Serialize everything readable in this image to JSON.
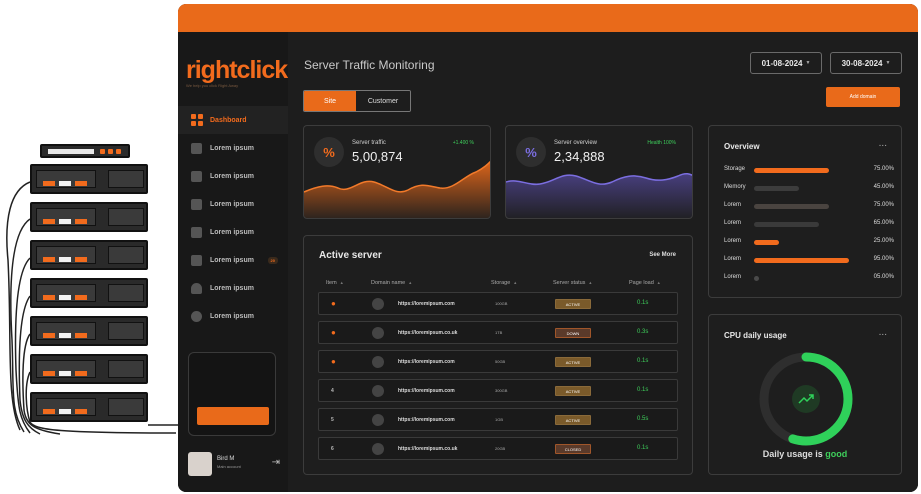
{
  "brand": {
    "logo_text": "rightclick",
    "tagline": "We help you click Right Away"
  },
  "sidebar": {
    "items": [
      {
        "label": "Dashboard",
        "icon": "dashboard-icon",
        "active": true
      },
      {
        "label": "Lorem ipsum",
        "icon": "chart-icon"
      },
      {
        "label": "Lorem ipsum",
        "icon": "grid-icon"
      },
      {
        "label": "Lorem ipsum",
        "icon": "document-icon"
      },
      {
        "label": "Lorem ipsum",
        "icon": "calendar-icon"
      },
      {
        "label": "Lorem ipsum",
        "icon": "message-icon",
        "badge": "20"
      },
      {
        "label": "Lorem ipsum",
        "icon": "bell-icon"
      },
      {
        "label": "Lorem ipsum",
        "icon": "gear-icon"
      }
    ],
    "account": {
      "name": "Bird M",
      "role": "Main account"
    }
  },
  "header": {
    "title": "Server Traffic Monitoring",
    "date_from": "01-08-2024",
    "date_to": "30-08-2024",
    "add_domain_label": "Add domain",
    "tabs": [
      {
        "label": "Site",
        "active": true
      },
      {
        "label": "Customer"
      }
    ]
  },
  "stats": {
    "traffic": {
      "icon": "%",
      "label": "Server traffic",
      "value": "5,00,874",
      "delta": "+1.400 %"
    },
    "overview": {
      "icon": "%",
      "label": "Server overview",
      "value": "2,34,888",
      "delta": "Health 100%"
    }
  },
  "active_server": {
    "title": "Active server",
    "see_more": "See More",
    "columns": [
      "Item",
      "Domain name",
      "Storage",
      "Server status",
      "Page load"
    ],
    "rows": [
      {
        "item": "",
        "domain": "https://loremipsum.com",
        "storage": "100GB",
        "status": "ACTIVE",
        "load": "0.1s"
      },
      {
        "item": "",
        "domain": "https://loremipsum.co.uk",
        "storage": "1TB",
        "status": "DOWN",
        "load": "0.3s"
      },
      {
        "item": "",
        "domain": "https://loremipsum.com",
        "storage": "50GB",
        "status": "ACTIVE",
        "load": "0.1s"
      },
      {
        "item": "4",
        "domain": "https://loremipsum.com",
        "storage": "300GB",
        "status": "ACTIVE",
        "load": "0.1s"
      },
      {
        "item": "5",
        "domain": "https://loremipsum.com",
        "storage": "1GB",
        "status": "ACTIVE",
        "load": "0.5s"
      },
      {
        "item": "6",
        "domain": "https://loremipsum.co.uk",
        "storage": "20GB",
        "status": "CLOSED",
        "load": "0.1s"
      }
    ]
  },
  "overview": {
    "title": "Overview",
    "more": "...",
    "rows": [
      {
        "label": "Storage",
        "pct": "75.00%",
        "value": 0.75,
        "color": "#f26b1d"
      },
      {
        "label": "Memory",
        "pct": "45.00%",
        "value": 0.45,
        "color": "#3c3c3c"
      },
      {
        "label": "Lorem",
        "pct": "75.00%",
        "value": 0.75,
        "color": "#4a4440"
      },
      {
        "label": "Lorem",
        "pct": "65.00%",
        "value": 0.65,
        "color": "#3a3a3a"
      },
      {
        "label": "Lorem",
        "pct": "25.00%",
        "value": 0.25,
        "color": "#f26b1d"
      },
      {
        "label": "Lorem",
        "pct": "95.00%",
        "value": 0.95,
        "color": "#f26b1d"
      },
      {
        "label": "Lorem",
        "pct": "05.00%",
        "value": 0.05,
        "color": "#4a4a4a"
      }
    ]
  },
  "cpu": {
    "title": "CPU daily usage",
    "more": "...",
    "usage": 0.55,
    "footer_prefix": "Daily usage is",
    "footer_status": "good"
  },
  "colors": {
    "accent": "#e96a1a",
    "good": "#3ecf5b",
    "purple": "#6a5acd"
  }
}
